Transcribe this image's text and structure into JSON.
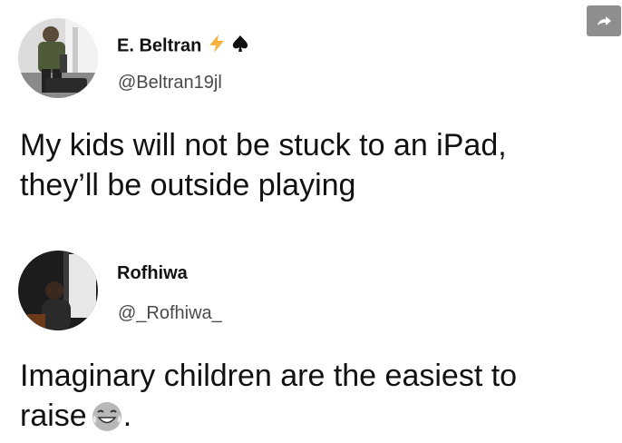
{
  "tweets": [
    {
      "display_name": "E. Beltran",
      "handle": "@Beltran19jl",
      "text_lines": [
        "My kids will not be stuck to an iPad,",
        "they’ll be outside playing"
      ],
      "badges": [
        "lightning-icon",
        "spade-icon"
      ],
      "colors": {
        "lightning": "#f5b342"
      }
    },
    {
      "display_name": "Rofhiwa",
      "handle": "@_Rofhiwa_",
      "text_lines": [
        "Imaginary children are the easiest to",
        "raise"
      ],
      "trailing_emoji": "tears-of-joy-emoji-icon",
      "trailing_punct": "."
    }
  ],
  "share_icon": "share-arrow-icon"
}
